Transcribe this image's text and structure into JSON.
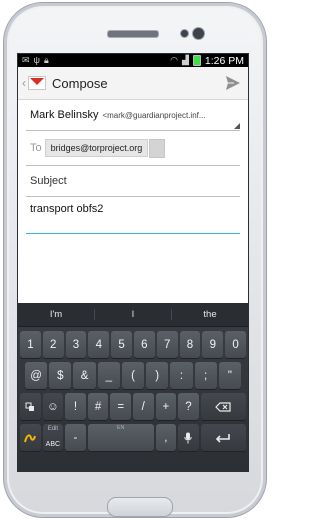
{
  "status_bar": {
    "time": "1:26 PM",
    "left_icons": [
      "message-icon",
      "usb-icon",
      "lock-icon"
    ],
    "right_icons": [
      "wifi-icon",
      "signal-icon",
      "battery-icon"
    ]
  },
  "action_bar": {
    "title": "Compose",
    "send_icon": "send-icon",
    "colors": {
      "accent": "#d93025",
      "focus": "#33b5e5"
    }
  },
  "compose": {
    "from_name": "Mark Belinsky",
    "from_email": "<mark@guardianproject.inf...",
    "to_label": "To",
    "to_recipients": [
      "bridges@torproject.org"
    ],
    "subject_placeholder": "Subject",
    "body_text": "transport obfs2"
  },
  "keyboard": {
    "suggestions": [
      "I'm",
      "I",
      "the"
    ],
    "row1": [
      "1",
      "2",
      "3",
      "4",
      "5",
      "6",
      "7",
      "8",
      "9",
      "0"
    ],
    "row2": [
      "@",
      "$",
      "&",
      "_",
      "(",
      ")",
      ":",
      ";",
      "\""
    ],
    "row3_keys": [
      "!",
      "#",
      "=",
      "/",
      "+",
      "?"
    ],
    "row4": {
      "edit_label": "Edit",
      "abc_label": "ABC",
      "dash_key": "-",
      "space_label": "EN",
      "comma_key": ","
    }
  }
}
